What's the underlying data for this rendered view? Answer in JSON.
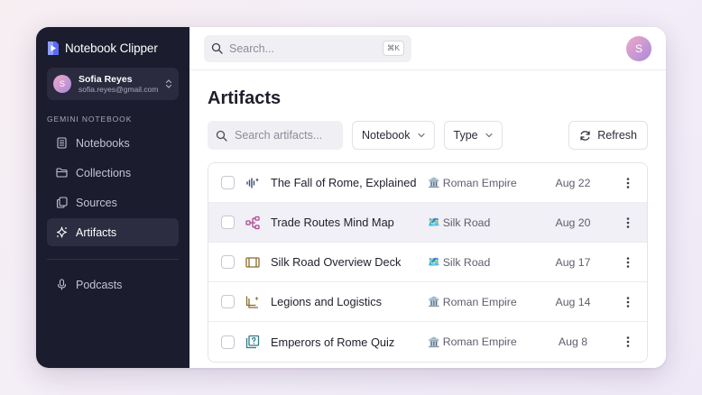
{
  "app": {
    "name": "Notebook Clipper"
  },
  "account": {
    "initial": "S",
    "name": "Sofia Reyes",
    "email": "sofia.reyes@gmail.com"
  },
  "sidebar": {
    "section_label": "GEMINI NOTEBOOK",
    "items": [
      {
        "label": "Notebooks",
        "icon": "notebook-icon"
      },
      {
        "label": "Collections",
        "icon": "folder-icon"
      },
      {
        "label": "Sources",
        "icon": "copy-icon"
      },
      {
        "label": "Artifacts",
        "icon": "sparkle-icon",
        "active": true
      }
    ],
    "secondary_items": [
      {
        "label": "Podcasts",
        "icon": "microphone-icon"
      }
    ]
  },
  "topbar": {
    "search_placeholder": "Search...",
    "shortcut": "⌘K",
    "avatar_initial": "S"
  },
  "page": {
    "title": "Artifacts",
    "search_placeholder": "Search artifacts...",
    "filters": {
      "notebook": "Notebook",
      "type": "Type"
    },
    "refresh_label": "Refresh"
  },
  "artifacts": [
    {
      "title": "The Fall of Rome, Explained",
      "type_icon": "audio-wave-icon",
      "notebook_emoji": "🏛️",
      "notebook": "Roman Empire",
      "date": "Aug 22"
    },
    {
      "title": "Trade Routes Mind Map",
      "type_icon": "mind-map-icon",
      "notebook_emoji": "🗺️",
      "notebook": "Silk Road",
      "date": "Aug 20",
      "highlighted": true
    },
    {
      "title": "Silk Road Overview Deck",
      "type_icon": "slides-icon",
      "notebook_emoji": "🗺️",
      "notebook": "Silk Road",
      "date": "Aug 17"
    },
    {
      "title": "Legions and Logistics",
      "type_icon": "report-icon",
      "notebook_emoji": "🏛️",
      "notebook": "Roman Empire",
      "date": "Aug 14"
    },
    {
      "title": "Emperors of Rome Quiz",
      "type_icon": "quiz-icon",
      "notebook_emoji": "🏛️",
      "notebook": "Roman Empire",
      "date": "Aug 8"
    }
  ],
  "colors": {
    "sidebar_bg": "#1b1c2e",
    "accent": "#a78bda",
    "audio_icon": "#3b4a7a",
    "mindmap_icon": "#b0488f",
    "slides_icon": "#8a6d2f",
    "report_icon": "#8a6d2f",
    "quiz_icon": "#2f7a8a"
  }
}
